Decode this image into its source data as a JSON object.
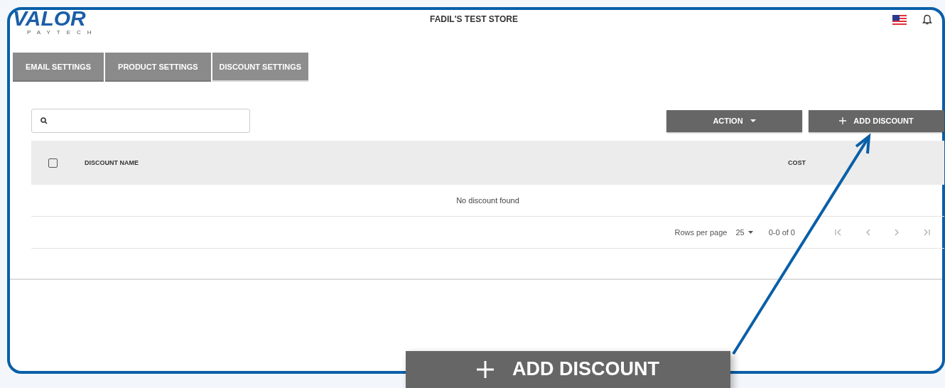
{
  "logo": {
    "name": "VALOR",
    "tagline": "PAYTECH"
  },
  "store_title": "FADIL'S TEST STORE",
  "tabs": [
    {
      "label": "EMAIL SETTINGS",
      "selected": false
    },
    {
      "label": "PRODUCT SETTINGS",
      "selected": false
    },
    {
      "label": "DISCOUNT SETTINGS",
      "selected": true
    }
  ],
  "buttons": {
    "action": "ACTION",
    "add": "ADD DISCOUNT"
  },
  "table": {
    "select_all_checked": false,
    "columns": [
      "DISCOUNT NAME",
      "COST"
    ],
    "empty_message": "No discount found"
  },
  "pagination": {
    "rows_label": "Rows per page",
    "rows_value": "25",
    "range": "0-0 of 0"
  },
  "callout": {
    "label": "ADD DISCOUNT"
  }
}
